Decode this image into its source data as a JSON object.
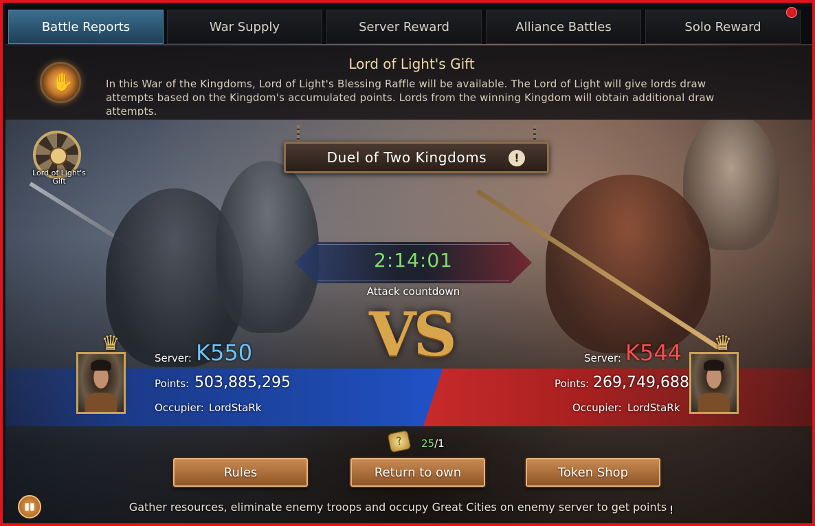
{
  "tabs": [
    {
      "label": "Battle Reports",
      "active": true
    },
    {
      "label": "War Supply",
      "active": false
    },
    {
      "label": "Server Reward",
      "active": false
    },
    {
      "label": "Alliance Battles",
      "active": false
    },
    {
      "label": "Solo Reward",
      "active": false
    }
  ],
  "gift": {
    "title": "Lord of Light's Gift",
    "description": "In this War of the Kingdoms, Lord of Light's Blessing Raffle will be available. The Lord of Light will give lords draw attempts based on the Kingdom's accumulated points. Lords from the winning Kingdom will obtain additional draw attempts.",
    "side_button_label": "Lord of Light's Gift"
  },
  "duel": {
    "title": "Duel of Two Kingdoms",
    "info_symbol": "!"
  },
  "countdown": {
    "value": "2:14:01",
    "label": "Attack countdown"
  },
  "vs_text": "VS",
  "left_kingdom": {
    "server_label": "Server:",
    "server": "K550",
    "points_label": "Points:",
    "points": "503,885,295",
    "occupier_label": "Occupier:",
    "occupier": "LordStaRk",
    "color": "#1d47a8"
  },
  "right_kingdom": {
    "server_label": "Server:",
    "server": "K544",
    "points_label": "Points:",
    "points": "269,749,688",
    "occupier_label": "Occupier:",
    "occupier": "LordStaRk",
    "color": "#c82a2a"
  },
  "tokens": {
    "current": "25",
    "sep_max": "/1"
  },
  "buttons": {
    "rules": "Rules",
    "return": "Return to own",
    "shop": "Token Shop"
  },
  "footer": {
    "text": "Gather resources, eliminate enemy troops and occupy Great Cities on enemy server to get points",
    "mark": "!"
  },
  "icons": {
    "gift": "lord-of-light-hand-icon",
    "wheel": "raffle-wheel-icon",
    "crown": "crown-icon",
    "token": "token-icon",
    "stats": "bar-chart-icon"
  },
  "colors": {
    "active_tab": "#3b6f8f",
    "timer": "#7ee06a",
    "border": "#e0141b",
    "button": "#c98a52"
  }
}
